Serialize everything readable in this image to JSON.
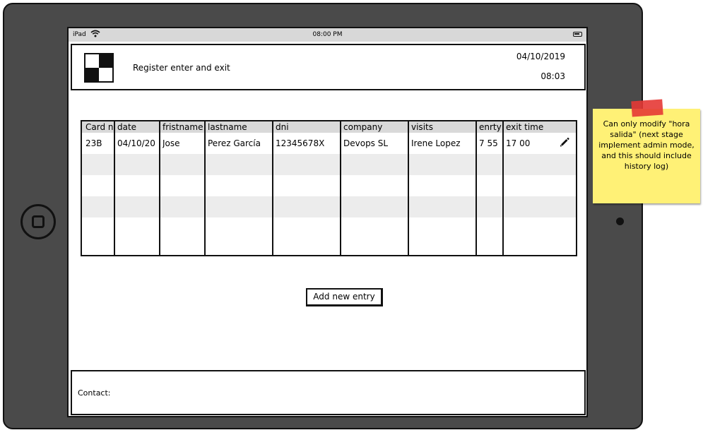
{
  "status_bar": {
    "device": "iPad",
    "time": "08:00 PM"
  },
  "header": {
    "title": "Register enter and exit",
    "date": "04/10/2019",
    "time": "08:03"
  },
  "table": {
    "columns": [
      "Card n",
      "date",
      "fristname",
      "lastname",
      "dni",
      "company",
      "visits",
      "enrty",
      "exit time"
    ],
    "rows": [
      [
        "23B",
        "04/10/20",
        "Jose",
        "Perez García",
        "12345678X",
        "Devops SL",
        "Irene Lopez",
        "7 55",
        "17 00"
      ]
    ],
    "edit_icon": "pencil-icon"
  },
  "actions": {
    "add_label": "Add new entry"
  },
  "footer": {
    "contact_label": "Contact:"
  },
  "sticky_note": {
    "text": "Can only modify \"hora salida\" (next stage implement admin mode, and this should include history log)"
  }
}
